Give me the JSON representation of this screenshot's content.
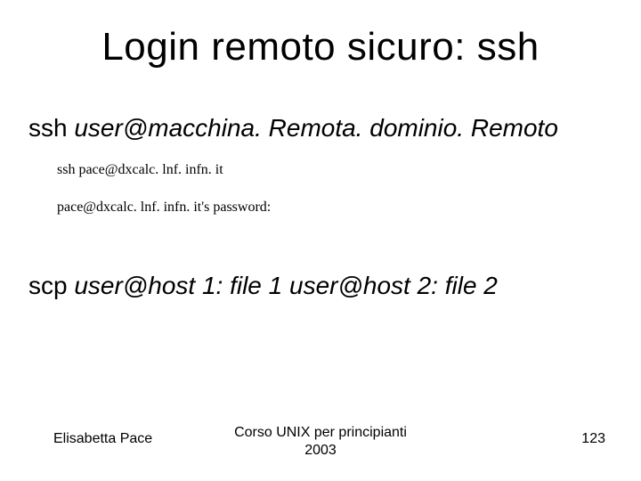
{
  "title": "Login remoto sicuro: ssh",
  "ssh": {
    "cmd": "ssh ",
    "args": "user@macchina. Remota. dominio. Remoto"
  },
  "terminal": {
    "line1": "ssh pace@dxcalc. lnf. infn. it",
    "line2": "pace@dxcalc. lnf. infn. it's password:"
  },
  "scp": {
    "cmd": "scp ",
    "args": "user@host 1: file 1 user@host 2: file 2"
  },
  "footer": {
    "author": "Elisabetta Pace",
    "center_line1": "Corso UNIX per principianti",
    "center_line2": "2003",
    "page": "123"
  }
}
